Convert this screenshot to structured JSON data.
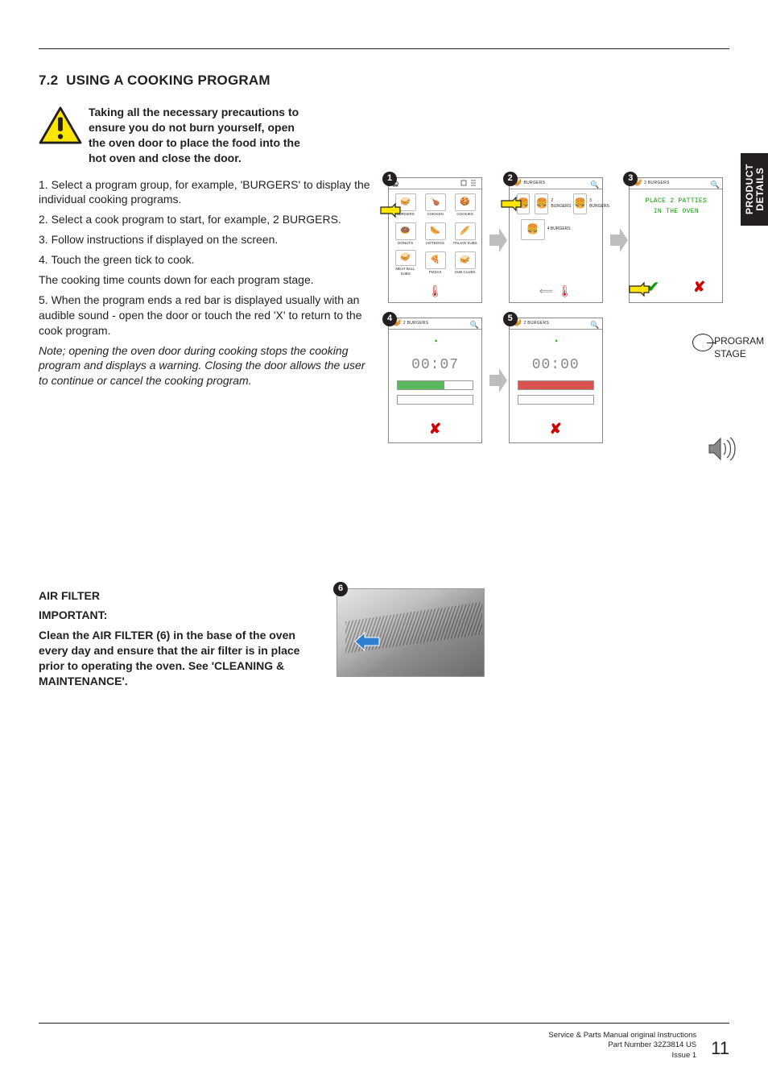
{
  "section": {
    "number": "7.2",
    "title": "USING A COOKING PROGRAM"
  },
  "side_tab": {
    "line1": "PRODUCT",
    "line2": "DETAILS"
  },
  "warning": {
    "text": "Taking all the necessary precautions to ensure you do not burn yourself, open the oven door to place the food into the hot oven and close the door."
  },
  "steps": {
    "s1": "1. Select a program group, for example, 'BURGERS' to display the individual cooking programs.",
    "s2": "2. Select a cook program to start, for example, 2 BURGERS.",
    "s3": "3. Follow instructions if displayed on the screen.",
    "s4": "4. Touch the green tick to cook.",
    "p_countdown": "The cooking time counts down for each program stage.",
    "s5": "5. When the program ends a red bar is displayed usually with an audible sound - open the door or touch the red 'X' to return to the cook program.",
    "note": "Note; opening the oven door during cooking stops the cooking program and displays a warning. Closing the door allows the user to continue or cancel the cooking program."
  },
  "screens": {
    "s1": {
      "badge": "1",
      "items": [
        "BURGERS",
        "CHICKEN",
        "COOKIES",
        "DONUTS",
        "HOTDOGS",
        "ITALIAN\nSUBS",
        "MEAT BALL\nSUBS",
        "PIZZAS",
        "SUB CLUBS"
      ]
    },
    "s2": {
      "badge": "2",
      "title": "BURGERS",
      "rows": [
        {
          "n": "1",
          "lbl": ""
        },
        {
          "n": "2",
          "lbl": "2 BURGERS"
        },
        {
          "n": "3",
          "lbl": "3 BURGERS"
        },
        {
          "n": "4",
          "lbl": "4 BURGERS"
        }
      ]
    },
    "s3": {
      "badge": "3",
      "title": "2 BURGERS",
      "lcd_line1": "PLACE 2 PATTIES",
      "lcd_line2": "IN THE OVEN"
    },
    "s4": {
      "badge": "4",
      "title": "2 BURGERS",
      "timer": "00:07"
    },
    "s5": {
      "badge": "5",
      "title": "2 BURGERS",
      "timer": "00:00"
    },
    "program_stage_label": "PROGRAM STAGE"
  },
  "air_filter": {
    "heading": "AIR FILTER",
    "important": "IMPORTANT:",
    "body": "Clean the AIR FILTER (6) in the base of the oven every day and ensure that the air filter is in place prior to operating the oven. See 'CLEANING & MAINTENANCE'.",
    "badge": "6"
  },
  "footer": {
    "line1": "Service & Parts Manual original Instructions",
    "line2": "Part Number 32Z3814 US",
    "line3": "Issue 1",
    "page": "11"
  }
}
